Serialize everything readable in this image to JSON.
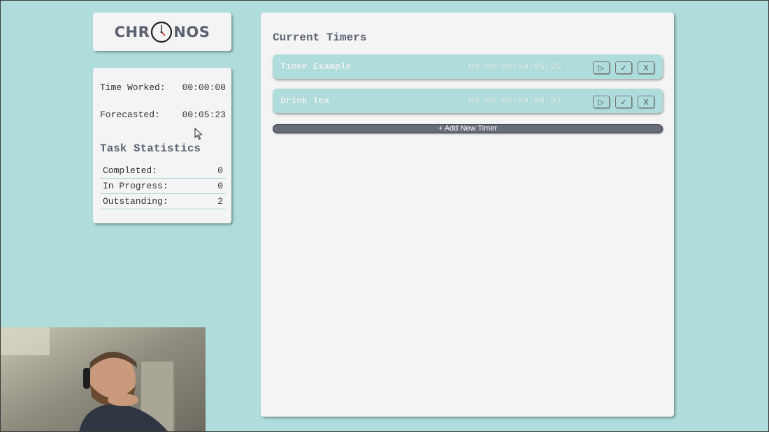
{
  "app": {
    "logo_left": "CHR",
    "logo_right": "NOS",
    "accent_color": "#aedddb",
    "button_color": "#666c78"
  },
  "summary": {
    "time_worked_label": "Time Worked:",
    "time_worked_value": "00:00:00",
    "forecasted_label": "Forecasted:",
    "forecasted_value": "00:05:23"
  },
  "statistics": {
    "heading": "Task Statistics",
    "rows": [
      {
        "label": "Completed:",
        "value": "0"
      },
      {
        "label": "In Progress:",
        "value": "0"
      },
      {
        "label": "Outstanding:",
        "value": "2"
      }
    ]
  },
  "timers": {
    "heading": "Current Timers",
    "items": [
      {
        "name": "Timer Example",
        "time": "00:00:00/00:05:20",
        "play_icon": "▷",
        "complete_icon": "✓",
        "delete_icon": "X"
      },
      {
        "name": "Drink Tea",
        "time": "00:00:00/00:00:03",
        "play_icon": "▷",
        "complete_icon": "✓",
        "delete_icon": "X"
      }
    ],
    "add_label": "+ Add New Timer"
  },
  "icons": {
    "logo_clock": "clock-icon",
    "cursor": "mouse-cursor-icon",
    "webcam": "webcam-overlay"
  }
}
